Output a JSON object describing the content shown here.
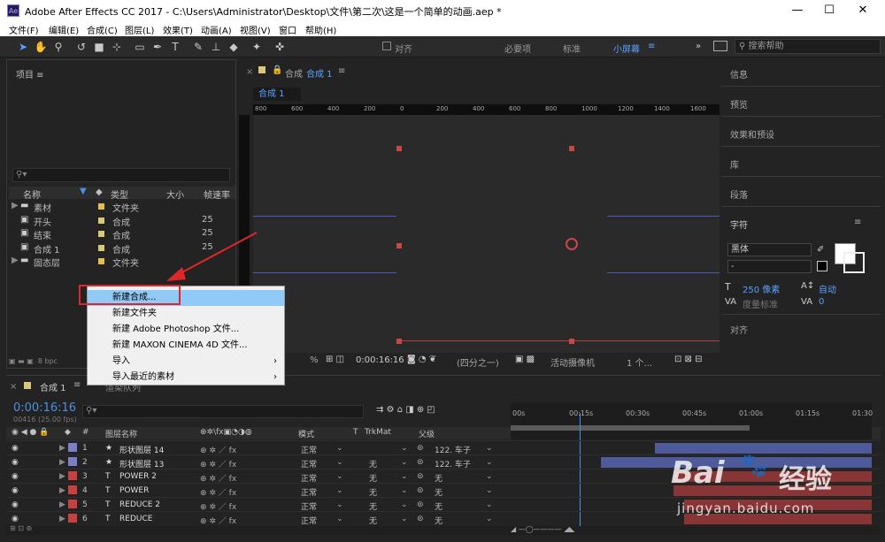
{
  "window": {
    "title": "Adobe After Effects CC 2017 - C:\\Users\\Administrator\\Desktop\\文件\\第二次\\这是一个简单的动画.aep *",
    "app_icon": "Ae"
  },
  "menu": [
    "文件(F)",
    "编辑(E)",
    "合成(C)",
    "图层(L)",
    "效果(T)",
    "动画(A)",
    "视图(V)",
    "窗口",
    "帮助(H)"
  ],
  "toolbar": {
    "align_label": "对齐",
    "workspaces": [
      "必要项",
      "标准",
      "小屏幕"
    ],
    "search_placeholder": "搜索帮助"
  },
  "project": {
    "title": "项目",
    "columns": [
      "名称",
      "类型",
      "大小",
      "帧速率"
    ],
    "bpc": "8 bpc",
    "items": [
      {
        "name": "素材",
        "type": "文件夹",
        "fps": "",
        "color": "#e0c050",
        "kind": "folder"
      },
      {
        "name": "开头",
        "type": "合成",
        "fps": "25",
        "color": "#d8c878",
        "kind": "comp"
      },
      {
        "name": "结束",
        "type": "合成",
        "fps": "25",
        "color": "#d8c878",
        "kind": "comp"
      },
      {
        "name": "合成 1",
        "type": "合成",
        "fps": "25",
        "color": "#d8c878",
        "kind": "comp"
      },
      {
        "name": "固态层",
        "type": "文件夹",
        "fps": "",
        "color": "#e0c050",
        "kind": "folder"
      }
    ]
  },
  "context_menu": [
    {
      "label": "新建合成...",
      "highlighted": true
    },
    {
      "label": "新建文件夹"
    },
    {
      "label": "新建 Adobe Photoshop 文件..."
    },
    {
      "label": "新建 MAXON CINEMA 4D 文件..."
    },
    {
      "label": "导入",
      "submenu": true
    },
    {
      "label": "导入最近的素材",
      "submenu": true
    }
  ],
  "comp_panel": {
    "tab": "合成",
    "tab_name": "合成 1",
    "breadcrumb": "合成 1",
    "ruler": [
      "800",
      "600",
      "400",
      "200",
      "0",
      "200",
      "400",
      "600",
      "800",
      "1000",
      "1200",
      "1400",
      "1600"
    ],
    "zoom": "%",
    "timecode": "0:00:16:16",
    "resolution": "(四分之一)",
    "camera": "活动摄像机",
    "views": "1 个..."
  },
  "right_panels": [
    "信息",
    "预览",
    "效果和预设",
    "库",
    "段落",
    "字符",
    "对齐"
  ],
  "character": {
    "font": "黑体",
    "style": "-",
    "size": "250 像素",
    "leading": "自动",
    "tracking": "度量标准",
    "tsume": "0"
  },
  "timeline": {
    "tab": "合成 1",
    "menu_tab": "渲染队列",
    "timecode": "0:00:16:16",
    "fps": "00416 (25.00 fps)",
    "headers": {
      "layer_name": "图层名称",
      "mode": "模式",
      "t": "T",
      "trkmat": "TrkMat",
      "parent": "父级",
      "hash": "#"
    },
    "time_marks": [
      "00s",
      "00:15s",
      "00:30s",
      "00:45s",
      "01:00s",
      "01:15s",
      "01:30"
    ],
    "layers": [
      {
        "num": "1",
        "name": "形状图层 14",
        "type": "star",
        "color": "#7a80c8",
        "mode": "正常",
        "trkmat": "",
        "parent": "122. 车子",
        "bar_color": "#4f5a9a",
        "bar_start": 0.4
      },
      {
        "num": "2",
        "name": "形状图层 13",
        "type": "star",
        "color": "#7a80c8",
        "mode": "正常",
        "trkmat": "无",
        "parent": "122. 车子",
        "bar_color": "#4f5a9a",
        "bar_start": 0.25
      },
      {
        "num": "3",
        "name": "POWER 2",
        "type": "text",
        "color": "#c84040",
        "mode": "正常",
        "trkmat": "无",
        "parent": "无",
        "bar_color": "#8a3535",
        "bar_start": 0.45
      },
      {
        "num": "4",
        "name": "POWER",
        "type": "text",
        "color": "#c84040",
        "mode": "正常",
        "trkmat": "无",
        "parent": "无",
        "bar_color": "#8a3535",
        "bar_start": 0.45
      },
      {
        "num": "5",
        "name": "REDUCE 2",
        "type": "text",
        "color": "#c84040",
        "mode": "正常",
        "trkmat": "无",
        "parent": "无",
        "bar_color": "#8a3535",
        "bar_start": 0.48
      },
      {
        "num": "6",
        "name": "REDUCE",
        "type": "text",
        "color": "#c84040",
        "mode": "正常",
        "trkmat": "无",
        "parent": "无",
        "bar_color": "#8a3535",
        "bar_start": 0.48
      }
    ]
  },
  "watermark": {
    "brand": "Bai",
    "brand2": "经验",
    "url": "jingyan.baidu.com"
  }
}
